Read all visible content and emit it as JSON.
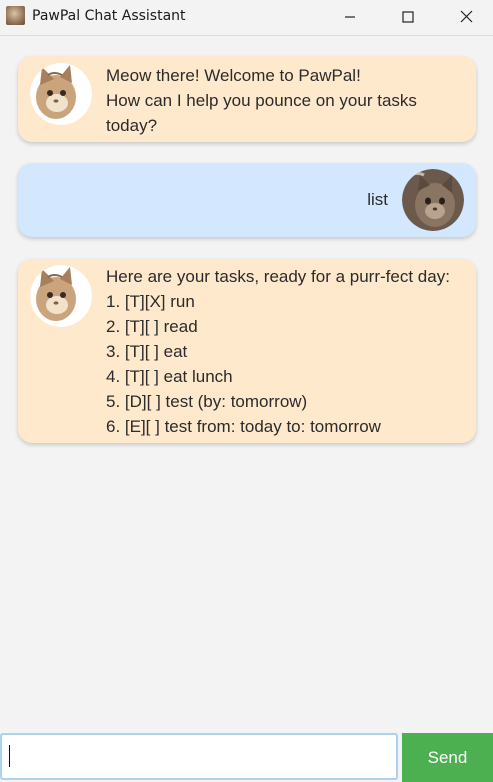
{
  "window": {
    "title": "PawPal Chat Assistant",
    "icon": "cat-app-icon",
    "controls": [
      "minimize-icon",
      "maximize-icon",
      "close-icon"
    ]
  },
  "messages": [
    {
      "sender": "bot",
      "lines": [
        "Meow there! Welcome to PawPal!",
        "How can I help you pounce on your tasks",
        "today?"
      ]
    },
    {
      "sender": "user",
      "lines": [
        "list"
      ]
    },
    {
      "sender": "bot",
      "lines": [
        "Here are your tasks, ready for a purr-fect day:",
        "1. [T][X] run",
        "2. [T][ ] read",
        "3. [T][ ] eat",
        "4. [T][ ] eat lunch",
        "5. [D][ ] test (by: tomorrow)",
        "6. [E][ ] test from: today to: tomorrow"
      ]
    }
  ],
  "input": {
    "value": "",
    "placeholder": ""
  },
  "send_button": {
    "label": "Send"
  },
  "colors": {
    "bot_bubble": "#ffe9cc",
    "user_bubble": "#d3e7ff",
    "send_button": "#4caf50",
    "background": "#f3f3f3"
  }
}
